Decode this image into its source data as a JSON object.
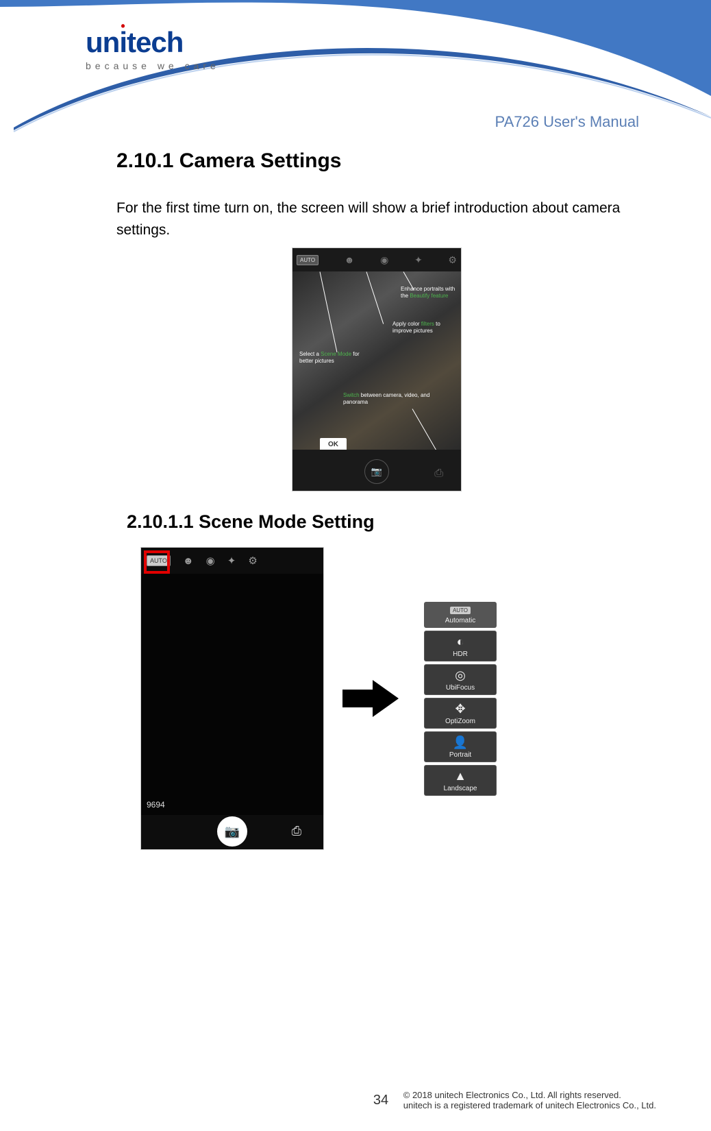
{
  "header": {
    "brand": "unitech",
    "tagline": "because we care",
    "manual_title": "PA726 User's Manual"
  },
  "section": {
    "heading_1": "2.10.1 Camera Settings",
    "intro_para": "For the first time turn on, the screen will show a brief introduction about camera settings.",
    "heading_2": "2.10.1.1  Scene Mode Setting"
  },
  "intro_screenshot": {
    "auto_chip": "AUTO",
    "callouts": {
      "c1_a": "Enhance portraits with the ",
      "c1_hl": "Beautify feature",
      "c2_a": "Apply color ",
      "c2_hl": "filters",
      "c2_b": " to improve pictures",
      "c3_a": "Select a ",
      "c3_hl": "Scene Mode",
      "c3_b": " for better pictures",
      "c4_hl": "Switch",
      "c4_b": " between camera, video, and panorama"
    },
    "ok_button": "OK"
  },
  "scene_screenshot": {
    "auto_chip": "AUTO",
    "frame_count": "9694"
  },
  "scene_menu": {
    "items": [
      {
        "label": "Automatic",
        "chip": "AUTO"
      },
      {
        "label": "HDR"
      },
      {
        "label": "UbiFocus"
      },
      {
        "label": "OptiZoom"
      },
      {
        "label": "Portrait"
      },
      {
        "label": "Landscape"
      }
    ]
  },
  "footer": {
    "page_number": "34",
    "line1": "© 2018 unitech Electronics Co., Ltd. All rights reserved.",
    "line2": "unitech is a registered trademark of unitech Electronics Co., Ltd."
  }
}
